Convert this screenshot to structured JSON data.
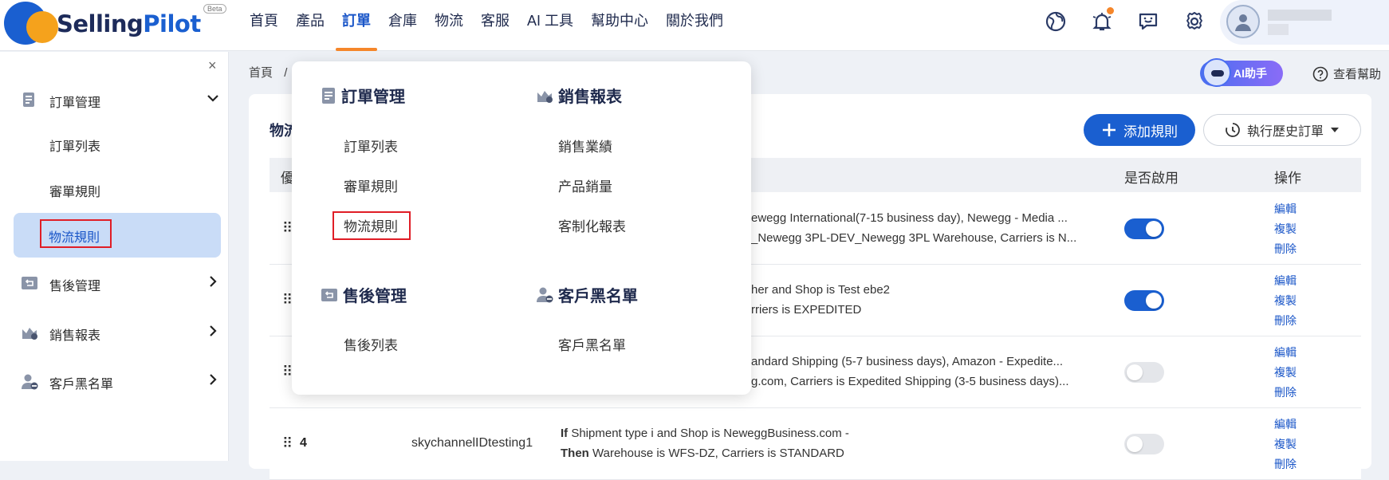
{
  "logo": {
    "name_a": "Selling",
    "name_b": "Pilot",
    "beta": "Beta"
  },
  "nav": [
    "首頁",
    "產品",
    "訂單",
    "倉庫",
    "物流",
    "客服",
    "AI 工具",
    "幫助中心",
    "關於我們"
  ],
  "nav_active": "訂單",
  "sidebar": {
    "close": "×",
    "groups": {
      "order_mgmt": "訂單管理",
      "after_sales": "售後管理",
      "sales_report": "銷售報表",
      "blacklist": "客戶黑名單"
    },
    "sub": {
      "order_list": "訂單列表",
      "review_rules": "審單規則",
      "logistics_rules": "物流規則"
    }
  },
  "breadcrumb": {
    "home": "首頁",
    "sep": "/"
  },
  "ai_button": "AI助手",
  "help_link": "查看幫助",
  "card": {
    "title": "物流",
    "add_button": "添加規則",
    "history_button": "執行歷史訂單"
  },
  "table": {
    "headers": {
      "priority": "優",
      "enabled": "是否啟用",
      "actions": "操作"
    },
    "ops": {
      "edit": "編輯",
      "copy": "複製",
      "delete": "刪除"
    },
    "rows": [
      {
        "line1": "ewegg International(7-15 business day), Newegg - Media ...",
        "line2": "_Newegg 3PL-DEV_Newegg 3PL Warehouse, Carriers is N...",
        "enabled": true
      },
      {
        "line1": "her and Shop is Test ebe2",
        "line2": "rriers is EXPEDITED",
        "enabled": true
      },
      {
        "line1": "andard Shipping (5-7 business days), Amazon - Expedite...",
        "line2": "g.com, Carriers is Expedited Shipping (3-5 business days)...",
        "enabled": false
      },
      {
        "num": "4",
        "name": "skychannelIDtesting1",
        "if_kw": "If",
        "line1": " Shipment type i and Shop is NeweggBusiness.com -",
        "then_kw": "Then",
        "line2": " Warehouse is WFS-DZ, Carriers is STANDARD",
        "enabled": false
      }
    ]
  },
  "dropdown": {
    "order_mgmt": {
      "title": "訂單管理",
      "items": [
        "訂單列表",
        "審單規則",
        "物流規則"
      ]
    },
    "sales_report": {
      "title": "銷售報表",
      "items": [
        "銷售業績",
        "产品銷量",
        "客制化報表"
      ]
    },
    "after_sales": {
      "title": "售後管理",
      "items": [
        "售後列表"
      ]
    },
    "blacklist": {
      "title": "客戶黑名單",
      "items": [
        "客戶黑名單"
      ]
    }
  },
  "colors": {
    "brand": "#1a5fd0",
    "accent": "#f5862a",
    "highlight_box": "#e01d26"
  }
}
